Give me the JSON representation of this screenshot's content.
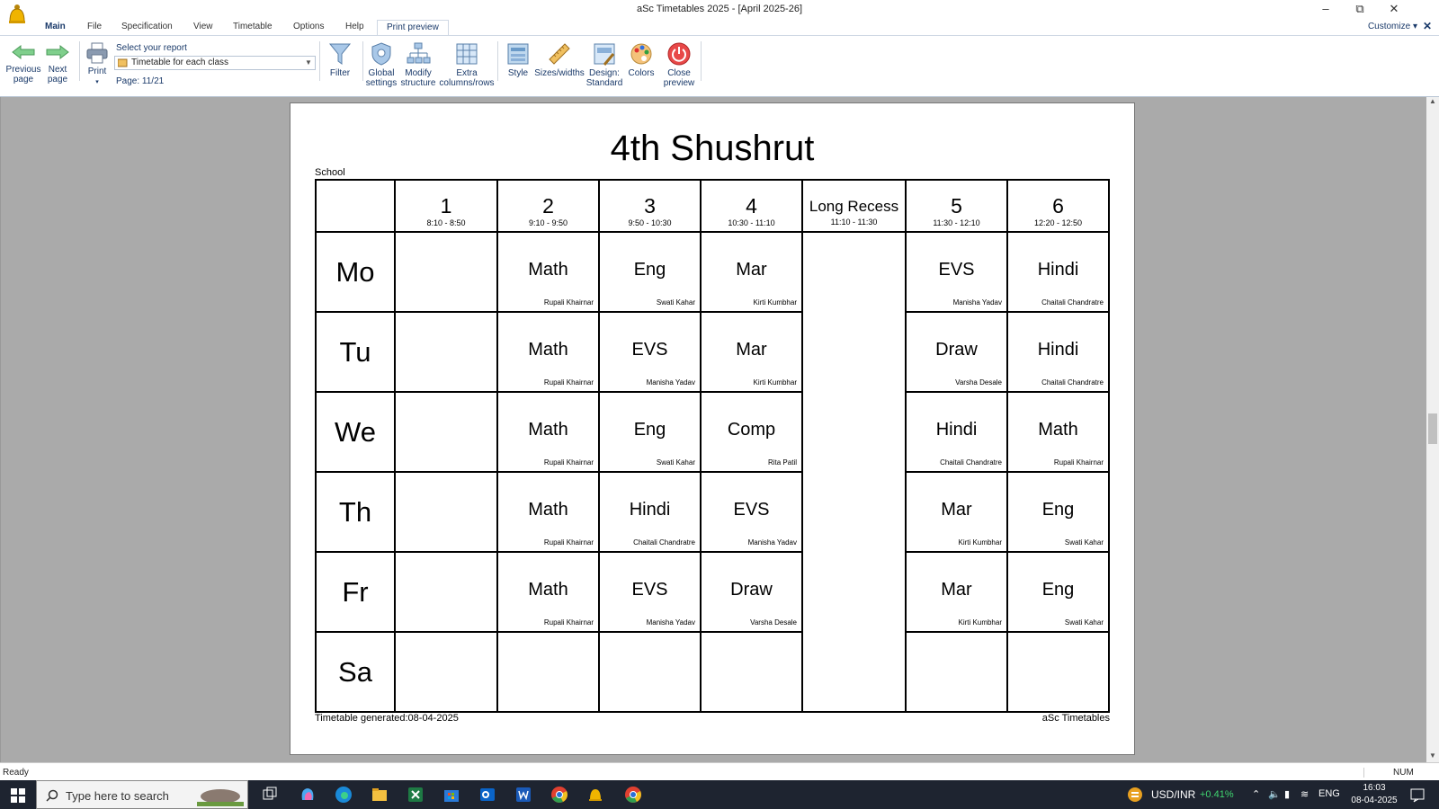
{
  "window": {
    "title": "aSc Timetables 2025  - [April 2025-26]"
  },
  "tabs": [
    "Main",
    "File",
    "Specification",
    "View",
    "Timetable",
    "Options",
    "Help",
    "Print preview"
  ],
  "customize": {
    "label": "Customize",
    "arrow": "▾",
    "close": "✕"
  },
  "ribbon": {
    "previous_page": [
      "Previous",
      "page"
    ],
    "next_page": [
      "Next",
      "page"
    ],
    "print": "Print",
    "select_label": "Select your report",
    "select_value": "Timetable for each class",
    "page": "Page: 11/21",
    "filter": "Filter",
    "global_settings": [
      "Global",
      "settings"
    ],
    "modify_structure": [
      "Modify",
      "structure"
    ],
    "extra_columns": [
      "Extra",
      "columns/rows"
    ],
    "style": "Style",
    "sizes_widths": "Sizes/widths",
    "design": [
      "Design:",
      "Standard"
    ],
    "colors": "Colors",
    "close_preview": [
      "Close",
      "preview"
    ]
  },
  "timetable": {
    "title": "4th Shushrut",
    "school_label": "School",
    "periods": [
      {
        "num": "1",
        "time": "8:10 - 8:50"
      },
      {
        "num": "2",
        "time": "9:10 - 9:50"
      },
      {
        "num": "3",
        "time": "9:50 - 10:30"
      },
      {
        "num": "4",
        "time": "10:30 - 11:10"
      },
      {
        "num": "Long Recess",
        "time": "11:10 - 11:30"
      },
      {
        "num": "5",
        "time": "11:30 - 12:10"
      },
      {
        "num": "6",
        "time": "12:20 - 12:50"
      }
    ],
    "days": [
      {
        "day": "Mo",
        "cells": [
          null,
          {
            "subject": "Math",
            "teacher": "Rupali Khairnar"
          },
          {
            "subject": "Eng",
            "teacher": "Swati Kahar"
          },
          {
            "subject": "Mar",
            "teacher": "Kirti Kumbhar"
          },
          {
            "subject": "EVS",
            "teacher": "Manisha Yadav"
          },
          {
            "subject": "Hindi",
            "teacher": "Chaitali Chandratre"
          }
        ]
      },
      {
        "day": "Tu",
        "cells": [
          null,
          {
            "subject": "Math",
            "teacher": "Rupali Khairnar"
          },
          {
            "subject": "EVS",
            "teacher": "Manisha Yadav"
          },
          {
            "subject": "Mar",
            "teacher": "Kirti Kumbhar"
          },
          {
            "subject": "Draw",
            "teacher": "Varsha Desale"
          },
          {
            "subject": "Hindi",
            "teacher": "Chaitali Chandratre"
          }
        ]
      },
      {
        "day": "We",
        "cells": [
          null,
          {
            "subject": "Math",
            "teacher": "Rupali Khairnar"
          },
          {
            "subject": "Eng",
            "teacher": "Swati Kahar"
          },
          {
            "subject": "Comp",
            "teacher": "Rita Patil"
          },
          {
            "subject": "Hindi",
            "teacher": "Chaitali Chandratre"
          },
          {
            "subject": "Math",
            "teacher": "Rupali Khairnar"
          }
        ]
      },
      {
        "day": "Th",
        "cells": [
          null,
          {
            "subject": "Math",
            "teacher": "Rupali Khairnar"
          },
          {
            "subject": "Hindi",
            "teacher": "Chaitali Chandratre"
          },
          {
            "subject": "EVS",
            "teacher": "Manisha Yadav"
          },
          {
            "subject": "Mar",
            "teacher": "Kirti Kumbhar"
          },
          {
            "subject": "Eng",
            "teacher": "Swati Kahar"
          }
        ]
      },
      {
        "day": "Fr",
        "cells": [
          null,
          {
            "subject": "Math",
            "teacher": "Rupali Khairnar"
          },
          {
            "subject": "EVS",
            "teacher": "Manisha Yadav"
          },
          {
            "subject": "Draw",
            "teacher": "Varsha Desale"
          },
          {
            "subject": "Mar",
            "teacher": "Kirti Kumbhar"
          },
          {
            "subject": "Eng",
            "teacher": "Swati Kahar"
          }
        ]
      },
      {
        "day": "Sa",
        "cells": [
          null,
          null,
          null,
          null,
          null,
          null
        ]
      }
    ],
    "footer_left": "Timetable generated:08-04-2025",
    "footer_right": "aSc Timetables"
  },
  "status": {
    "text": "Ready",
    "num": "NUM"
  },
  "taskbar": {
    "search_placeholder": "Type here to search",
    "ticker": "USD/INR",
    "ticker_change": "+0.41%",
    "language": "ENG",
    "time": "16:03",
    "date": "08-04-2025"
  },
  "colors": {
    "ribbon_text": "#1a3a6a",
    "preview_bg": "#aaaaaa",
    "taskbar": "#1e2430",
    "ticker_up": "#3fd46f"
  }
}
